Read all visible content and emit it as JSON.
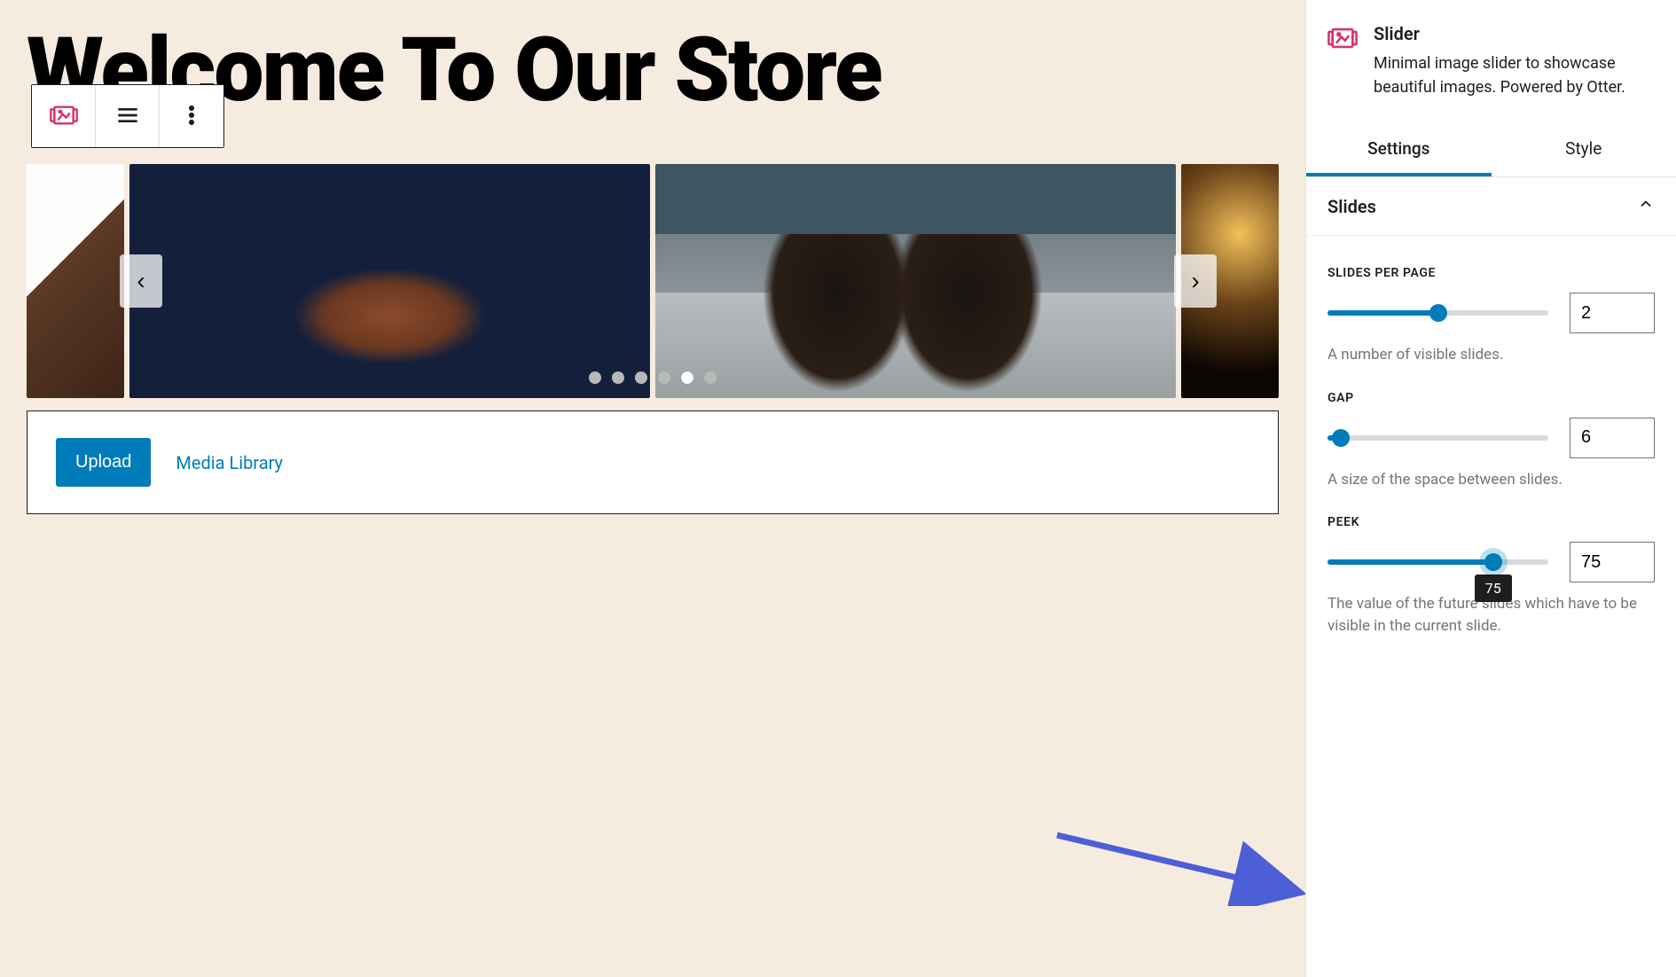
{
  "editor": {
    "page_title": "Welcome To Our Store",
    "toolbar": {
      "block_type_icon": "slider-icon",
      "align_icon": "align-icon",
      "more_icon": "more-icon"
    },
    "slider": {
      "prev_icon": "‹",
      "next_icon": "›",
      "dot_count": 6,
      "active_dot": 4
    },
    "media_bar": {
      "upload_label": "Upload",
      "media_library_label": "Media Library"
    }
  },
  "sidebar": {
    "block": {
      "title": "Slider",
      "description": "Minimal image slider to showcase beautiful images. Powered by Otter."
    },
    "tabs": {
      "settings": "Settings",
      "style": "Style",
      "active": "settings"
    },
    "panel": {
      "title": "Slides",
      "expanded": true
    },
    "controls": {
      "slides_per_page": {
        "label": "SLIDES PER PAGE",
        "value": 2,
        "min": 1,
        "max": 4,
        "help": "A number of visible slides."
      },
      "gap": {
        "label": "GAP",
        "value": 6,
        "min": 0,
        "max": 100,
        "help": "A size of the space between slides."
      },
      "peek": {
        "label": "PEEK",
        "value": 75,
        "min": 0,
        "max": 100,
        "tooltip": "75",
        "help": "The value of the future slides which have to be visible in the current slide."
      }
    }
  }
}
